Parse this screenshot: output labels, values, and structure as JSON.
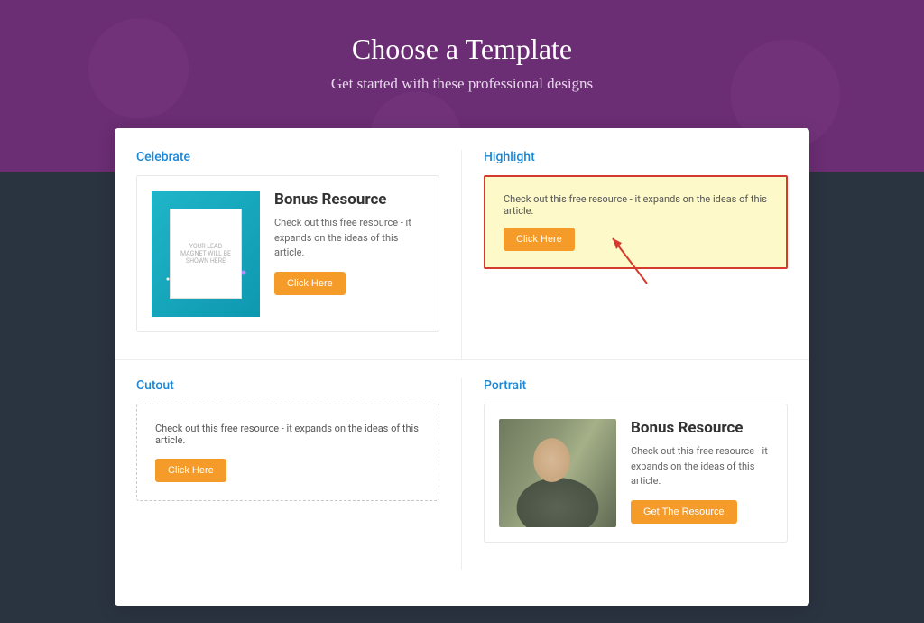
{
  "hero": {
    "title": "Choose a Template",
    "subtitle": "Get started with these professional designs"
  },
  "templates": {
    "celebrate": {
      "name": "Celebrate",
      "thumb_text": "YOUR LEAD MAGNET WILL BE SHOWN HERE",
      "title": "Bonus Resource",
      "desc": "Check out this free resource - it expands on the ideas of this article.",
      "btn": "Click Here"
    },
    "highlight": {
      "name": "Highlight",
      "desc": "Check out this free resource - it expands on the ideas of this article.",
      "btn": "Click Here"
    },
    "cutout": {
      "name": "Cutout",
      "desc": "Check out this free resource - it expands on the ideas of this article.",
      "btn": "Click Here"
    },
    "portrait": {
      "name": "Portrait",
      "title": "Bonus Resource",
      "desc": "Check out this free resource - it expands on the ideas of this article.",
      "btn": "Get The Resource"
    }
  }
}
